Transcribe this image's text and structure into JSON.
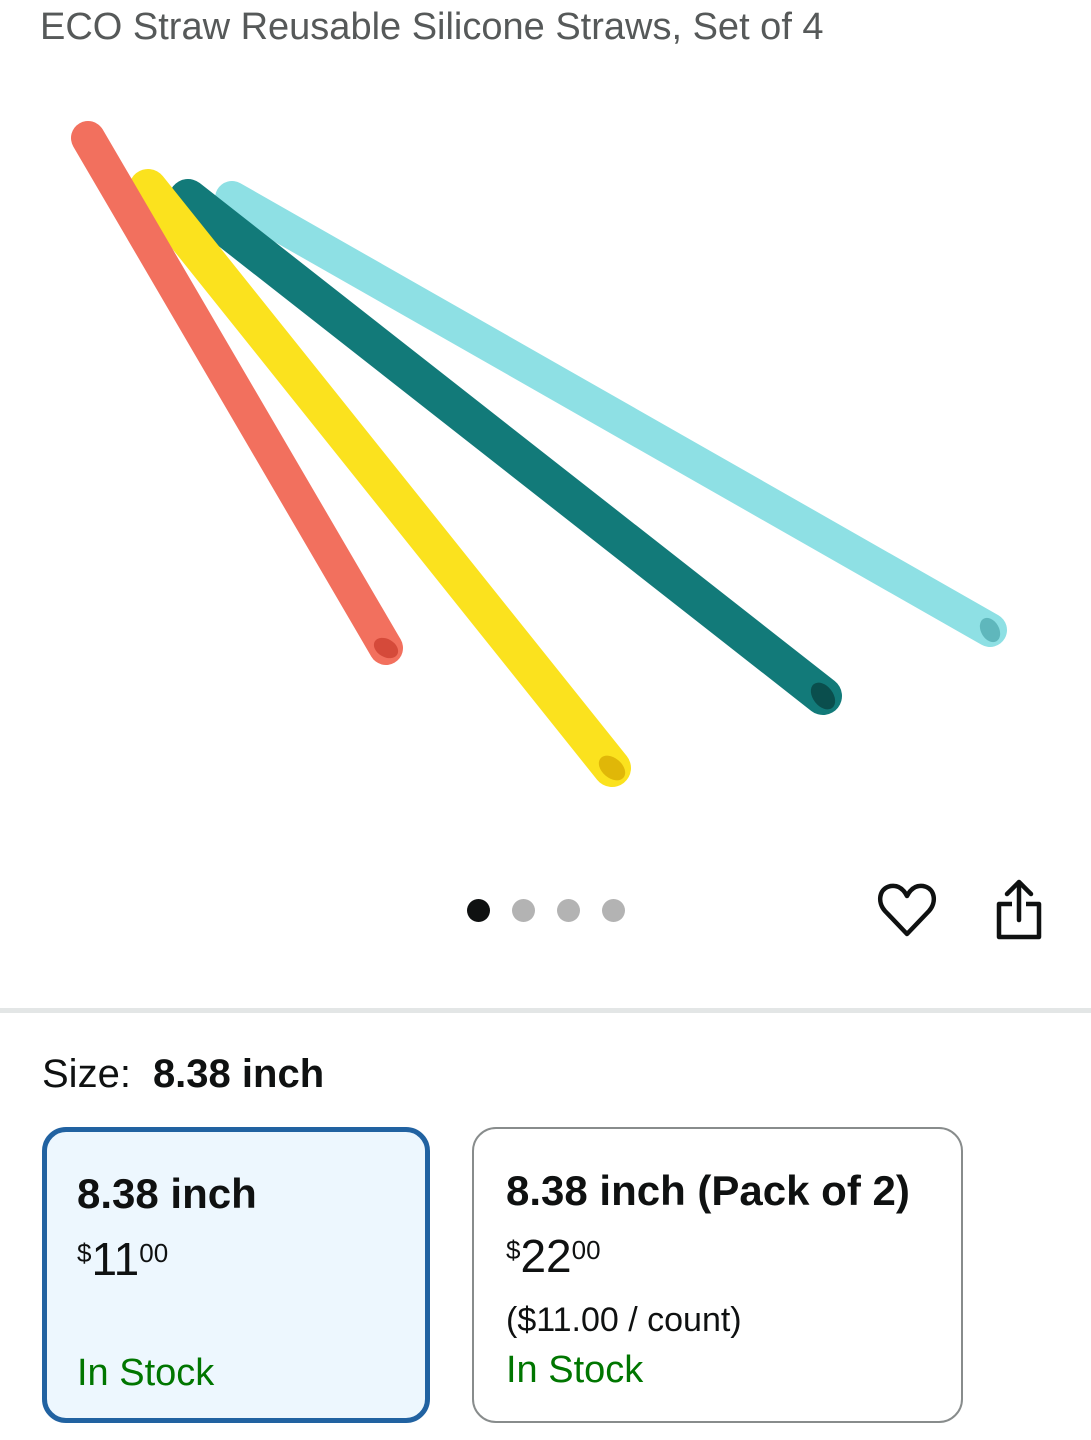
{
  "product": {
    "title": "ECO Straw Reusable Silicone Straws, Set of 4",
    "image": {
      "icon": "product-photo-four-silicone-straws",
      "straw_colors": [
        "#f2705e",
        "#fbe21e",
        "#127a79",
        "#8ee0e4"
      ]
    }
  },
  "carousel": {
    "count": 4,
    "active_index": 0
  },
  "actions": {
    "wishlist_icon": "heart-icon",
    "share_icon": "share-icon"
  },
  "size": {
    "label": "Size:",
    "selected_value": "8.38 inch"
  },
  "options": [
    {
      "name": "8.38 inch",
      "price_symbol": "$",
      "price_whole": "11",
      "price_fraction": "00",
      "stock": "In Stock",
      "selected": true
    },
    {
      "name": "8.38 inch (Pack of 2)",
      "price_symbol": "$",
      "price_whole": "22",
      "price_fraction": "00",
      "unit_price": "($11.00 / count)",
      "stock": "In Stock",
      "selected": false
    }
  ],
  "colors": {
    "selected_border": "#2162a1",
    "selected_bg": "#edf7fe",
    "stock_green": "#007600"
  }
}
